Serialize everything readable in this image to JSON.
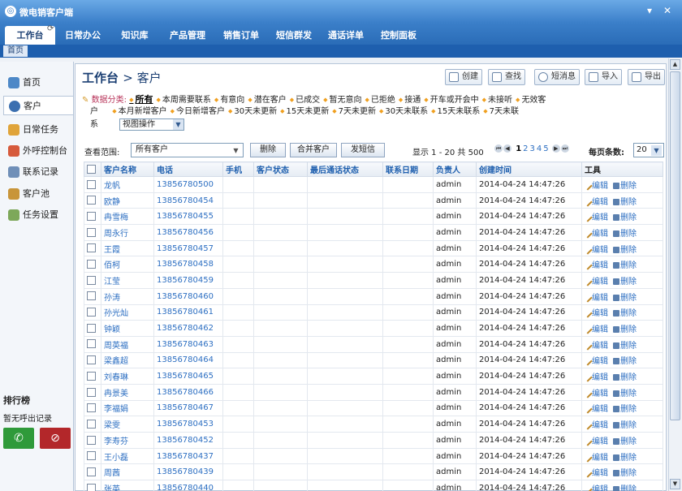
{
  "app": {
    "title": "微电销客户端",
    "colors": {
      "accent": "#3b7fc9",
      "link": "#2d6fc2",
      "title": "#1b3f73"
    }
  },
  "window": {
    "minimize": "▾",
    "close": "✕"
  },
  "nav": {
    "tabs": [
      "工作台",
      "日常办公",
      "知识库",
      "产品管理",
      "销售订单",
      "短信群发",
      "通话详单",
      "控制面板"
    ],
    "refresh_icon": "refresh-icon"
  },
  "breadcrumb": {
    "home": "首页"
  },
  "sidebar": {
    "items": [
      {
        "label": "首页",
        "icon": "home-icon"
      },
      {
        "label": "客户",
        "icon": "user-icon"
      },
      {
        "label": "日常任务",
        "icon": "task-icon"
      },
      {
        "label": "外呼控制台",
        "icon": "phone-console-icon"
      },
      {
        "label": "联系记录",
        "icon": "record-icon"
      },
      {
        "label": "客户池",
        "icon": "customer-pool-icon"
      },
      {
        "label": "任务设置",
        "icon": "settings-icon"
      }
    ],
    "rank_title": "排行榜",
    "no_record": "暂无呼出记录"
  },
  "header": {
    "title": "工作台",
    "sub": "> 客户",
    "buttons": [
      "创建",
      "查找",
      "短消息",
      "导入",
      "导出"
    ]
  },
  "filters": {
    "label": "数据分类:",
    "line1": [
      "所有",
      "本周需要联系",
      "有意向",
      "潜在客户",
      "已成交",
      "暂无意向",
      "已拒绝",
      "接通",
      "开车或开会中",
      "未接听",
      "无效客"
    ],
    "line2_prefix": "户",
    "line2": [
      "本月新增客户",
      "今日新增客户",
      "30天未更新",
      "15天未更新",
      "7天未更新",
      "30天未联系",
      "15天未联系",
      "7天未联"
    ],
    "line3_prefix": "系",
    "view_select": "视图操作"
  },
  "toolbar": {
    "scope_label": "查看范围:",
    "scope_value": "所有客户",
    "delete": "删除",
    "merge": "合并客户",
    "sms": "发短信",
    "page_info": "显示  1 - 20 共  500",
    "pages": [
      "1",
      "2",
      "3",
      "4",
      "5"
    ],
    "per_page_label": "每页条数:",
    "per_page_value": "20"
  },
  "table": {
    "columns": [
      "客户名称",
      "电话",
      "手机",
      "客户状态",
      "最后通话状态",
      "联系日期",
      "负责人",
      "创建时间",
      "工具"
    ],
    "edit": "编辑",
    "delete": "删除",
    "rows": [
      {
        "name": "龙帆",
        "phone": "13856780500",
        "owner": "admin",
        "created": "2014-04-24 14:47:26"
      },
      {
        "name": "欧静",
        "phone": "13856780454",
        "owner": "admin",
        "created": "2014-04-24 14:47:26"
      },
      {
        "name": "冉雪梅",
        "phone": "13856780455",
        "owner": "admin",
        "created": "2014-04-24 14:47:26"
      },
      {
        "name": "周永行",
        "phone": "13856780456",
        "owner": "admin",
        "created": "2014-04-24 14:47:26"
      },
      {
        "name": "王霞",
        "phone": "13856780457",
        "owner": "admin",
        "created": "2014-04-24 14:47:26"
      },
      {
        "name": "佰柯",
        "phone": "13856780458",
        "owner": "admin",
        "created": "2014-04-24 14:47:26"
      },
      {
        "name": "江莹",
        "phone": "13856780459",
        "owner": "admin",
        "created": "2014-04-24 14:47:26"
      },
      {
        "name": "孙涛",
        "phone": "13856780460",
        "owner": "admin",
        "created": "2014-04-24 14:47:26"
      },
      {
        "name": "孙光灿",
        "phone": "13856780461",
        "owner": "admin",
        "created": "2014-04-24 14:47:26"
      },
      {
        "name": "钟颖",
        "phone": "13856780462",
        "owner": "admin",
        "created": "2014-04-24 14:47:26"
      },
      {
        "name": "周英福",
        "phone": "13856780463",
        "owner": "admin",
        "created": "2014-04-24 14:47:26"
      },
      {
        "name": "梁鑫超",
        "phone": "13856780464",
        "owner": "admin",
        "created": "2014-04-24 14:47:26"
      },
      {
        "name": "刘春琳",
        "phone": "13856780465",
        "owner": "admin",
        "created": "2014-04-24 14:47:26"
      },
      {
        "name": "冉景美",
        "phone": "13856780466",
        "owner": "admin",
        "created": "2014-04-24 14:47:26"
      },
      {
        "name": "李福娟",
        "phone": "13856780467",
        "owner": "admin",
        "created": "2014-04-24 14:47:26"
      },
      {
        "name": "梁雯",
        "phone": "13856780453",
        "owner": "admin",
        "created": "2014-04-24 14:47:26"
      },
      {
        "name": "李寿芬",
        "phone": "13856780452",
        "owner": "admin",
        "created": "2014-04-24 14:47:26"
      },
      {
        "name": "王小磊",
        "phone": "13856780437",
        "owner": "admin",
        "created": "2014-04-24 14:47:26"
      },
      {
        "name": "周茜",
        "phone": "13856780439",
        "owner": "admin",
        "created": "2014-04-24 14:47:26"
      },
      {
        "name": "张英",
        "phone": "13856780440",
        "owner": "admin",
        "created": "2014-04-24 14:47:26"
      }
    ]
  }
}
